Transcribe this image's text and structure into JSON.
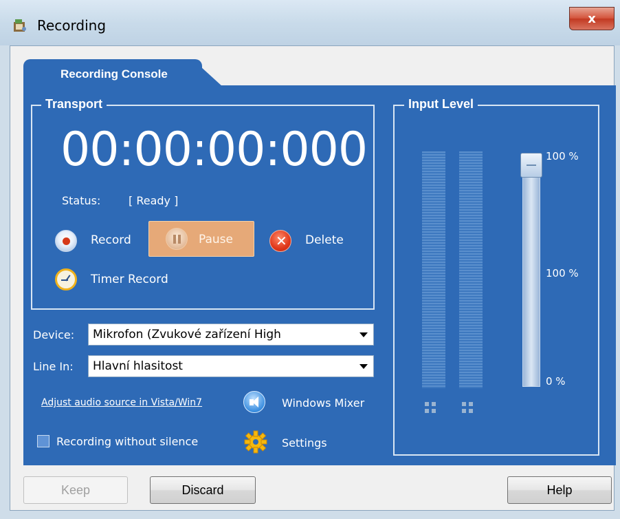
{
  "window": {
    "title": "Recording",
    "close_label": "x"
  },
  "tab": {
    "label": "Recording Console"
  },
  "transport": {
    "title": "Transport",
    "time": "00:00:00:000",
    "status_label": "Status:",
    "status_value": "[ Ready ]",
    "record_label": "Record",
    "pause_label": "Pause",
    "delete_label": "Delete",
    "timer_label": "Timer Record"
  },
  "device": {
    "label": "Device:",
    "value": "Mikrofon (Zvukové zařízení High"
  },
  "line_in": {
    "label": "Line In:",
    "value": "Hlavní hlasitost"
  },
  "links": {
    "adjust_source": "Adjust audio source in Vista/Win7"
  },
  "windows_mixer_label": "Windows Mixer",
  "settings_label": "Settings",
  "silence_checkbox_label": "Recording without silence",
  "input_level": {
    "title": "Input Level",
    "scale_top": "100 %",
    "scale_mid": "100 %",
    "scale_bottom": "0 %",
    "slider_value_percent": 100
  },
  "buttons": {
    "keep": "Keep",
    "discard": "Discard",
    "help": "Help"
  },
  "colors": {
    "panel": "#2e6ab6",
    "pause_highlight": "#e6a978",
    "close": "#c23a22"
  }
}
